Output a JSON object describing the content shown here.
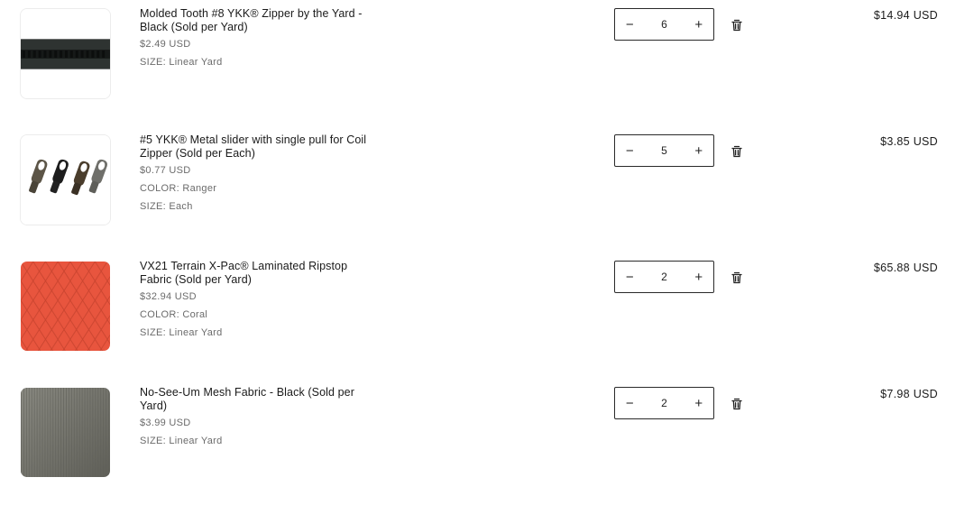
{
  "cart": {
    "items": [
      {
        "title_line1": "Molded Tooth #8 YKK® Zipper by the Yard -",
        "title_line2": "Black (Sold per Yard)",
        "unit_price": "$2.49 USD",
        "options": [
          {
            "name": "SIZE:",
            "value": "Linear Yard"
          }
        ],
        "quantity": "6",
        "decrease_label": "−",
        "increase_label": "+",
        "line_total": "$14.94 USD",
        "image_icon": "zipper-image",
        "remove_icon": "trash-icon"
      },
      {
        "title_line1": "#5 YKK® Metal slider with single pull for Coil",
        "title_line2": "Zipper (Sold per Each)",
        "unit_price": "$0.77 USD",
        "options": [
          {
            "name": "COLOR:",
            "value": "Ranger"
          },
          {
            "name": "SIZE:",
            "value": "Each"
          }
        ],
        "quantity": "5",
        "decrease_label": "−",
        "increase_label": "+",
        "line_total": "$3.85 USD",
        "image_icon": "slider-pulls-image",
        "remove_icon": "trash-icon"
      },
      {
        "title_line1": "VX21 Terrain X-Pac® Laminated Ripstop",
        "title_line2": "Fabric (Sold per Yard)",
        "unit_price": "$32.94 USD",
        "options": [
          {
            "name": "COLOR:",
            "value": "Coral"
          },
          {
            "name": "SIZE:",
            "value": "Linear Yard"
          }
        ],
        "quantity": "2",
        "decrease_label": "−",
        "increase_label": "+",
        "line_total": "$65.88 USD",
        "image_icon": "coral-fabric-image",
        "image_color": "#e8553e",
        "remove_icon": "trash-icon"
      },
      {
        "title_line1": "No-See-Um Mesh Fabric - Black (Sold per",
        "title_line2": "Yard)",
        "unit_price": "$3.99 USD",
        "options": [
          {
            "name": "SIZE:",
            "value": "Linear Yard"
          }
        ],
        "quantity": "2",
        "decrease_label": "−",
        "increase_label": "+",
        "line_total": "$7.98 USD",
        "image_icon": "mesh-fabric-image",
        "image_color": "#6e6e66",
        "remove_icon": "trash-icon"
      }
    ]
  }
}
